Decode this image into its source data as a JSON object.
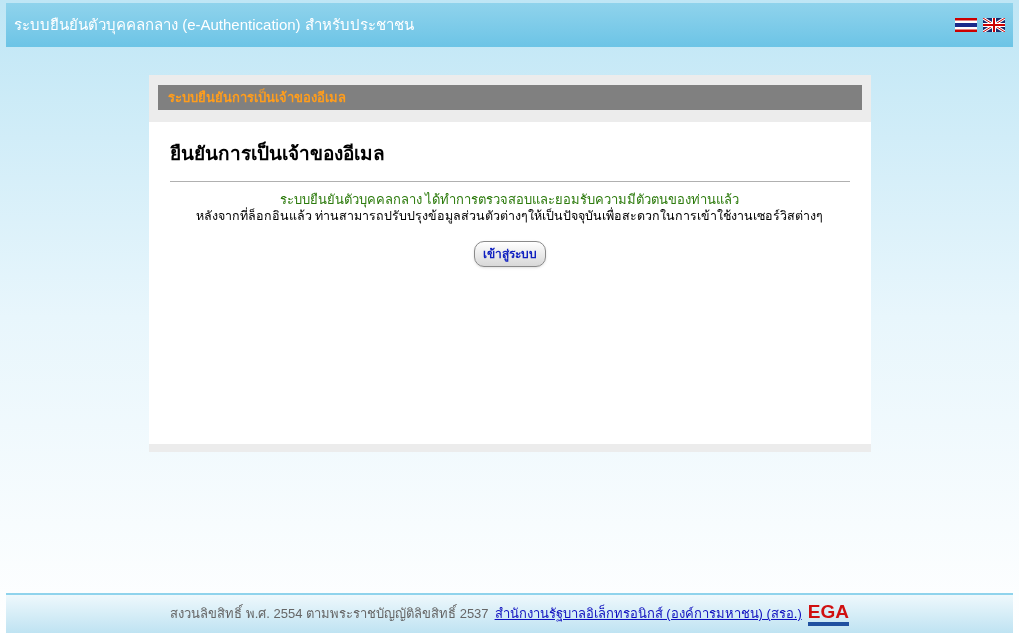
{
  "header": {
    "title": "ระบบยืนยันตัวบุคคลกลาง (e-Authentication) สำหรับประชาชน",
    "languages": [
      {
        "kind": "thai"
      },
      {
        "kind": "uk"
      }
    ]
  },
  "panel": {
    "bar_title": "ระบบยืนยันการเป็นเจ้าของอีเมล",
    "heading": "ยืนยันการเป็นเจ้าของอีเมล",
    "success_message": "ระบบยืนยันตัวบุคคลกลาง ได้ทำการตรวจสอบและยอมรับความมีตัวตนของท่านแล้ว",
    "info_message": "หลังจากที่ล็อกอินแล้ว ท่านสามารถปรับปรุงข้อมูลส่วนตัวต่างๆให้เป็นปัจจุบันเพื่อสะดวกในการเข้าใช้งานเซอร์วิสต่างๆ",
    "button": "เข้าสู่ระบบ"
  },
  "footer": {
    "copyright": "สงวนลิขสิทธิ์ พ.ศ. 2554 ตามพระราชบัญญัติลิขสิทธิ์ 2537",
    "link": "สำนักงานรัฐบาลอิเล็กทรอนิกส์ (องค์การมหาชน) (สรอ.)",
    "logo": "EGA"
  }
}
